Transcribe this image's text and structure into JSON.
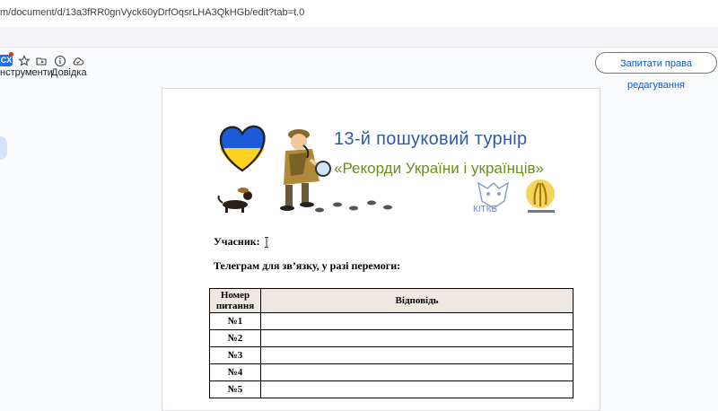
{
  "browser": {
    "url": "m/document/d/13a3fRR0gnVyck60yDrfOqsrLHA3QkHGb/edit?tab=t.0"
  },
  "toolbar": {
    "badge_text": "CX",
    "tools_label": "нструменти",
    "help_label": "Довідка",
    "request_edit_label": "Запитати права редагування"
  },
  "banner": {
    "title_line1": "13-й пошуковий турнір",
    "title_line2": "«Рекорди України і українців»",
    "logo_text": "КІТКБ"
  },
  "form": {
    "participant_label": "Учасник:",
    "telegram_label": "Телеграм для зв’язку, у разі перемоги:"
  },
  "table": {
    "col_num": "Номер питання",
    "col_answer": "Відповідь",
    "rows": [
      {
        "num": "№1",
        "answer": ""
      },
      {
        "num": "№2",
        "answer": ""
      },
      {
        "num": "№3",
        "answer": ""
      },
      {
        "num": "№4",
        "answer": ""
      },
      {
        "num": "№5",
        "answer": ""
      }
    ]
  },
  "colors": {
    "accent": "#1a73e8",
    "title_blue": "#2e5aa8",
    "title_green": "#6b8e23",
    "header_bg": "#efe9e2"
  }
}
